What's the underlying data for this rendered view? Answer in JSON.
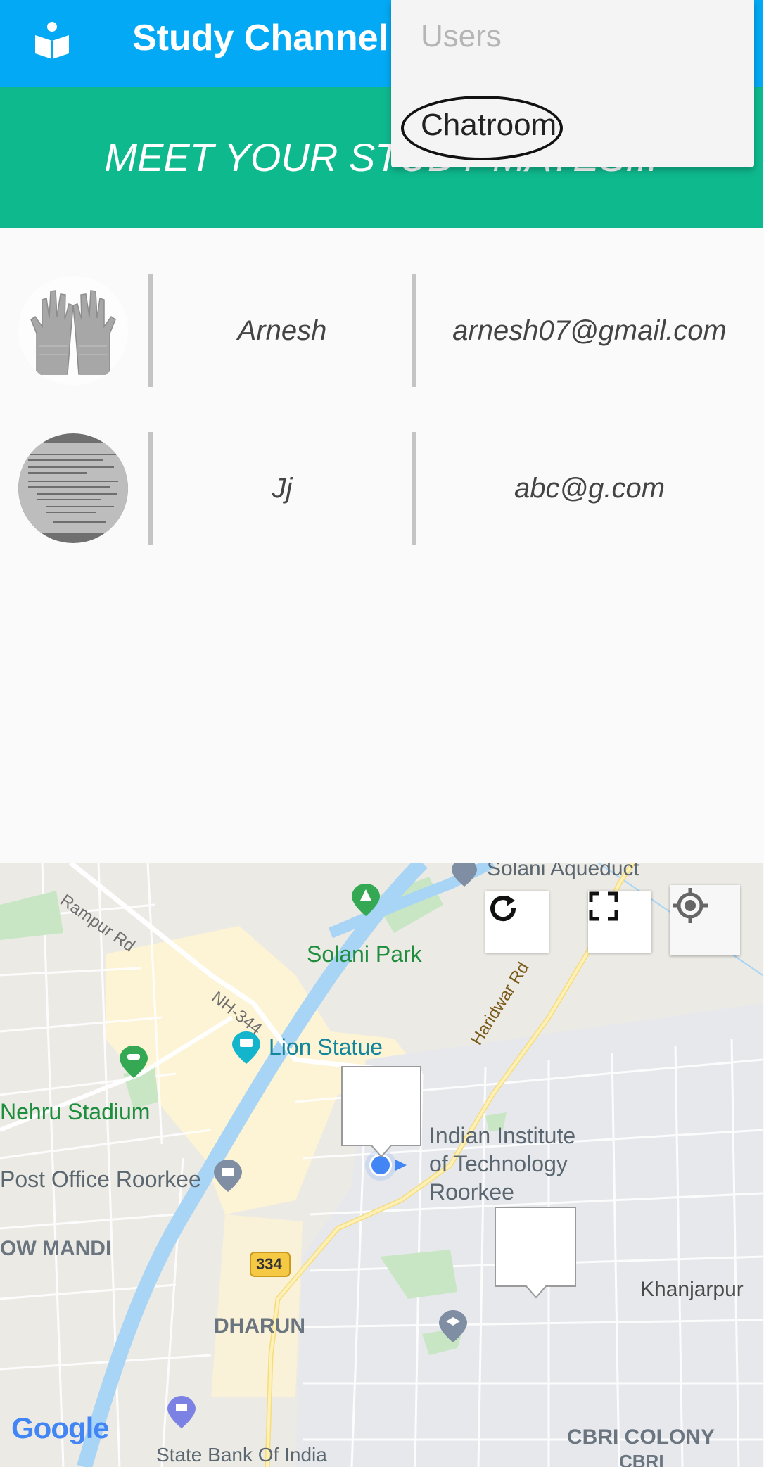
{
  "app": {
    "title": "Study Channel",
    "icon": "book-reader-icon",
    "colors": {
      "appbar": "#03a9f4",
      "banner": "#0fb98e"
    }
  },
  "banner": {
    "text": "MEET YOUR STUDY MATES..."
  },
  "overflow_menu": {
    "items": [
      {
        "label": "Users",
        "enabled": false
      },
      {
        "label": "Chatroom",
        "enabled": true,
        "circled": true
      }
    ]
  },
  "users": [
    {
      "name": "Arnesh",
      "email": "arnesh07@gmail.com",
      "avatar": "gloves-photo"
    },
    {
      "name": "Jj",
      "email": "abc@g.com",
      "avatar": "document-photo"
    }
  ],
  "map": {
    "labels": {
      "solani_aqueduct": "Solani Aqueduct",
      "rampur_rd": "Rampur Rd",
      "solani_park": "Solani Park",
      "haridwar_rd": "Haridwar Rd",
      "nh344": "NH-344",
      "lion_statue": "Lion Statue",
      "nehru_stadium": "Nehru Stadium",
      "iit_1": "Indian Institute",
      "iit_2": "of Technology",
      "iit_3": "Roorkee",
      "post_office": "Post Office Roorkee",
      "ow_mandi": "OW MANDI",
      "road_334": "334",
      "khanjarpur": "Khanjarpur",
      "dharun": "DHARUN",
      "cbri_colony": "CBRI COLONY",
      "cbri": "CBRI",
      "sbi": "State Bank Of India",
      "google": "Google"
    },
    "controls": [
      "refresh-icon",
      "fullscreen-icon",
      "my-location-icon"
    ]
  }
}
